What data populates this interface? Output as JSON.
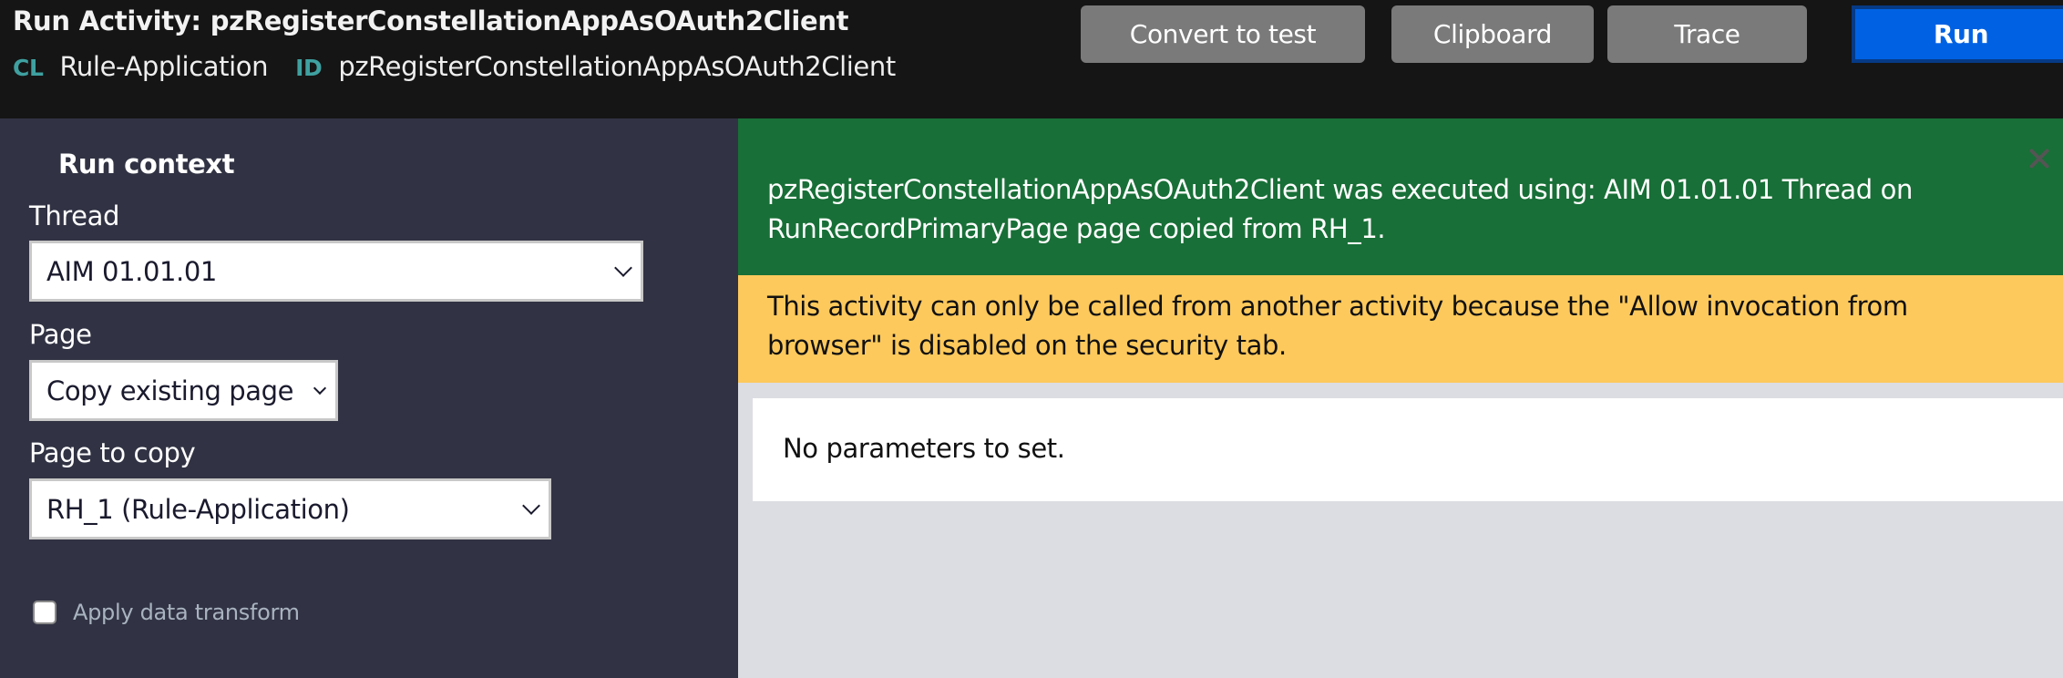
{
  "header": {
    "title_prefix": "Run",
    "title_type": "Activity:",
    "title_name": "pzRegisterConstellationAppAsOAuth2Client",
    "class_tag": "CL",
    "class_value": "Rule-Application",
    "id_tag": "ID",
    "id_value": "pzRegisterConstellationAppAsOAuth2Client"
  },
  "toolbar": {
    "convert_label": "Convert to test",
    "clipboard_label": "Clipboard",
    "trace_label": "Trace",
    "run_label": "Run"
  },
  "sidebar": {
    "heading": "Run context",
    "thread_label": "Thread",
    "thread_value": "AIM 01.01.01",
    "page_label": "Page",
    "page_value": "Copy existing page",
    "page_to_copy_label": "Page to copy",
    "page_to_copy_value": "RH_1 (Rule-Application)",
    "apply_transform_label": "Apply data transform",
    "apply_transform_checked": false
  },
  "main": {
    "success_message": "pzRegisterConstellationAppAsOAuth2Client was executed using: AIM 01.01.01 Thread on RunRecordPrimaryPage page copied from RH_1.",
    "warning_message": "This activity can only be called from another activity because the \"Allow invocation from browser\" is disabled on the security tab.",
    "params_message": "No parameters to set."
  },
  "colors": {
    "header_bg": "#151515",
    "sidebar_bg": "#313344",
    "success_bg": "#186f37",
    "warning_bg": "#fdc95c",
    "run_button": "#0062e3",
    "secondary_button": "#7a7a7a",
    "tag_color": "#3fa0a0"
  }
}
